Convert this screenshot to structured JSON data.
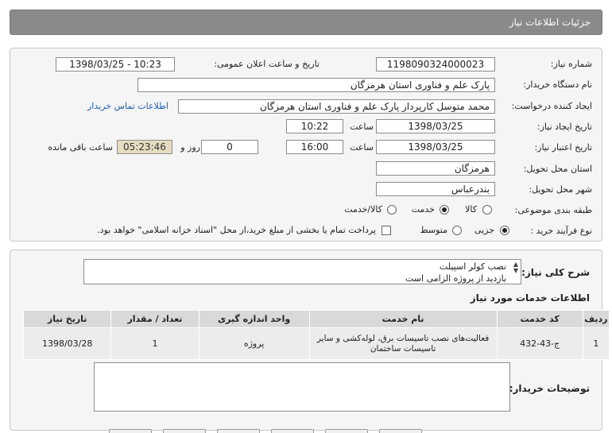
{
  "header": {
    "title": "جزئیات اطلاعات نیاز"
  },
  "form": {
    "need_number_label": "شماره نیاز:",
    "need_number": "1198090324000023",
    "announce_label": "تاریخ و ساعت اعلان عمومی:",
    "announce_value": "1398/03/25 - 10:23",
    "buyer_org_label": "نام دستگاه خریدار:",
    "buyer_org": "پارک علم و فناوری استان هرمزگان",
    "requester_label": "ایجاد کننده درخواست:",
    "requester": "محمد متوسل کارپرداز پارک علم و فناوری استان هرمزگان",
    "contact_link": "اطلاعات تماس خریدار",
    "created_label": "تاریخ ایجاد نیاز:",
    "created_date": "1398/03/25",
    "hour_label": "ساعت",
    "created_time": "10:22",
    "validity_label": "تاریخ اعتبار نیاز:",
    "validity_date": "1398/03/25",
    "validity_time": "16:00",
    "days_value": "0",
    "days_label": "روز و",
    "remaining_time": "05:23:46",
    "remaining_label": "ساعت باقی مانده",
    "province_label": "استان محل تحویل:",
    "province": "هرمزگان",
    "city_label": "شهر محل تحویل:",
    "city": "بندرعباس",
    "category_label": "طبقه بندی موضوعی:",
    "category_options": [
      "کالا",
      "خدمت",
      "کالا/خدمت"
    ],
    "category_selected": "خدمت",
    "process_label": "نوع فرآیند خرید :",
    "process_options": [
      "جزیی",
      "متوسط"
    ],
    "process_selected": "جزیی",
    "payment_note": "پرداخت تمام یا بخشی از مبلغ خرید،از محل \"اسناد خزانه اسلامی\" خواهد بود."
  },
  "description": {
    "label": "شرح کلی نیاز:",
    "line1": "نصب کولر اسپیلت",
    "line2": "بازدید از پروژه الزامی است"
  },
  "services": {
    "title": "اطلاعات خدمات مورد نیاز",
    "columns": [
      "ردیف",
      "کد خدمت",
      "نام خدمت",
      "واحد اندازه گیری",
      "تعداد / مقدار",
      "تاریخ نیاز"
    ],
    "rows": [
      {
        "row": "1",
        "code": "ج-43-432",
        "name": "فعالیت‌های نصب تاسیسات برق، لوله‌کشی و سایر تاسیسات ساختمان",
        "unit": "پروژه",
        "qty": "1",
        "date": "1398/03/28"
      }
    ]
  },
  "notes": {
    "label": "توضیحات خریدار:"
  }
}
